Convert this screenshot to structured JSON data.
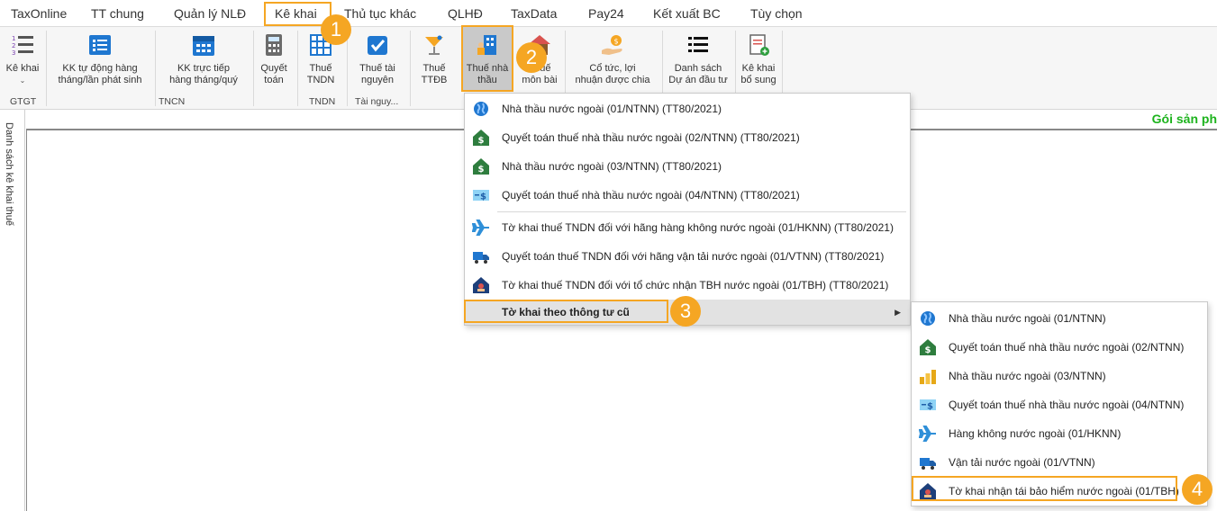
{
  "menubar": {
    "tabs": [
      "TaxOnline",
      "TT chung",
      "Quản lý NLĐ",
      "Kê khai",
      "Thủ tục khác",
      "QLHĐ",
      "TaxData",
      "Pay24",
      "Kết xuất BC",
      "Tùy chọn"
    ]
  },
  "ribbon": {
    "buttons": [
      {
        "l1": "Kê khai",
        "l2": ""
      },
      {
        "l1": "KK tự động hàng",
        "l2": "tháng/lần phát sinh"
      },
      {
        "l1": "KK trực tiếp",
        "l2": "hàng tháng/quý"
      },
      {
        "l1": "Quyết",
        "l2": "toán"
      },
      {
        "l1": "Thuế",
        "l2": "TNDN"
      },
      {
        "l1": "Thuế tài",
        "l2": "nguyên"
      },
      {
        "l1": "Thuế",
        "l2": "TTĐB"
      },
      {
        "l1": "Thuế nhà",
        "l2": "thầu"
      },
      {
        "l1": "Thuế",
        "l2": "môn bài"
      },
      {
        "l1": "Cổ tức, lợi",
        "l2": "nhuận được chia"
      },
      {
        "l1": "Danh sách",
        "l2": "Dự án đầu tư"
      },
      {
        "l1": "Kê khai",
        "l2": "bổ sung"
      }
    ],
    "groups": [
      "GTGT",
      "TNCN",
      "TNDN",
      "Tài nguy..."
    ]
  },
  "left_panel": {
    "label": "Danh sách kê khai thuế"
  },
  "promo": "Gói sản ph",
  "badges": [
    "1",
    "2",
    "3",
    "4"
  ],
  "menu1": {
    "items": [
      "Nhà thầu nước ngoài (01/NTNN) (TT80/2021)",
      "Quyết toán thuế nhà thầu nước ngoài (02/NTNN) (TT80/2021)",
      "Nhà thầu nước ngoài (03/NTNN) (TT80/2021)",
      "Quyết toán thuế nhà thầu nước ngoài (04/NTNN) (TT80/2021)",
      "Tờ khai thuế TNDN đối với hãng hàng không nước ngoài (01/HKNN) (TT80/2021)",
      "Quyết toán thuế TNDN đối với hãng vận tải nước ngoài (01/VTNN) (TT80/2021)",
      "Tờ khai thuế TNDN đối với tổ chức nhận TBH nước ngoài (01/TBH) (TT80/2021)"
    ],
    "submenu_label": "Tờ khai theo thông tư cũ"
  },
  "menu2": {
    "items": [
      "Nhà thầu nước ngoài (01/NTNN)",
      "Quyết toán thuế nhà thầu nước ngoài (02/NTNN)",
      "Nhà thầu nước ngoài (03/NTNN)",
      "Quyết toán thuế nhà thầu nước ngoài (04/NTNN)",
      "Hàng không nước ngoài (01/HKNN)",
      "Vận tải nước ngoài (01/VTNN)",
      "Tờ khai nhận tái bảo hiểm nước ngoài (01/TBH)"
    ]
  },
  "colors": {
    "accent": "#f5a623",
    "promo": "#1db31d",
    "blue": "#1f77d0"
  }
}
